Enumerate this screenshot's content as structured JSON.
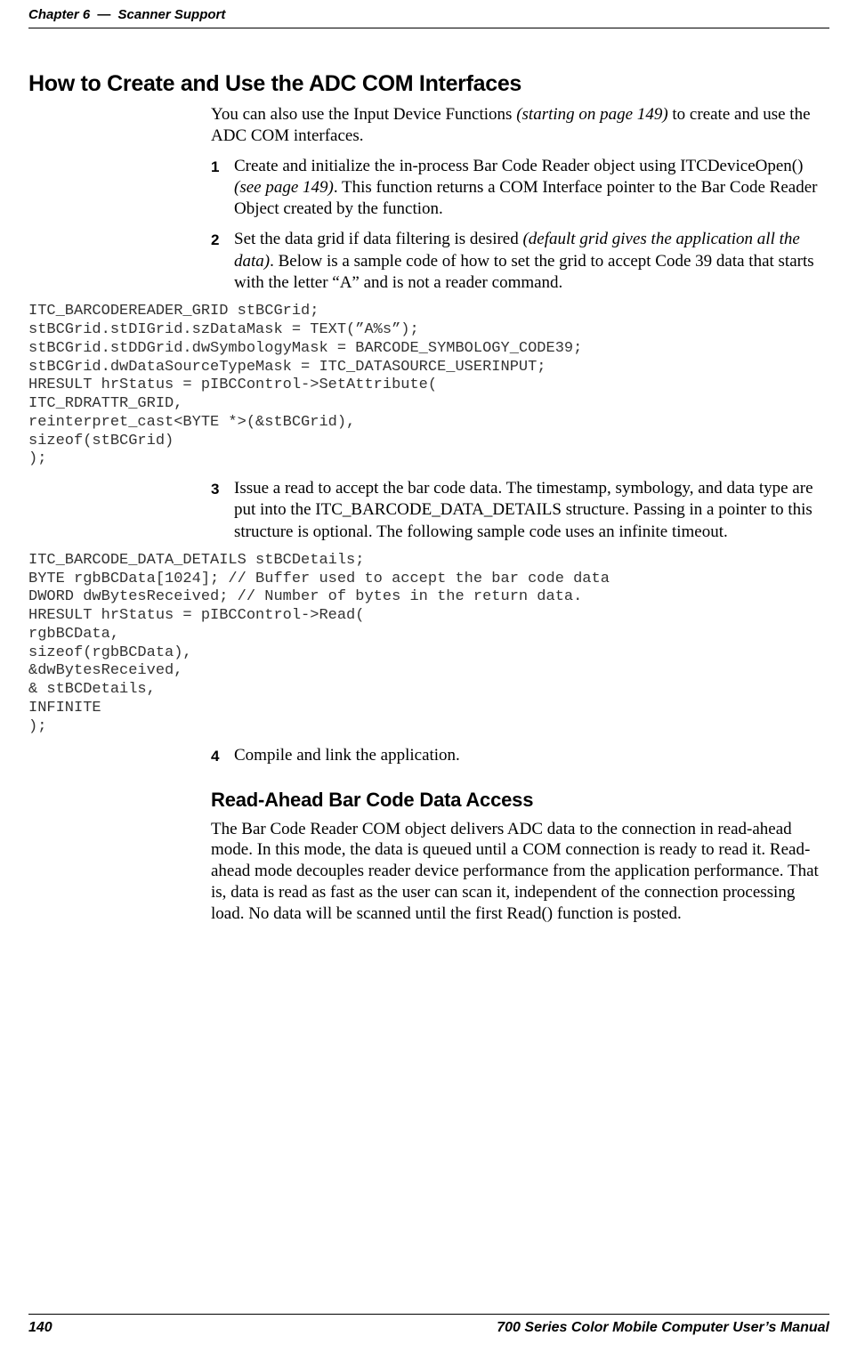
{
  "header": {
    "chapter_label": "Chapter 6",
    "separator": "—",
    "chapter_title": "Scanner Support"
  },
  "section_title": "How to Create and Use the ADC COM Interfaces",
  "intro": {
    "pre": "You can also use the Input Device Functions ",
    "italic": "(starting on page 149)",
    "post": " to create and use the ADC COM interfaces."
  },
  "steps12": {
    "s1": {
      "num": "1",
      "pre": "Create and initialize the in-process Bar Code Reader object using ITCDeviceOpen() ",
      "italic": "(see page 149)",
      "post": ". This function returns a COM Interface pointer to the Bar Code Reader Object created by the function."
    },
    "s2": {
      "num": "2",
      "pre": "Set the data grid if data filtering is desired ",
      "italic": "(default grid gives the application all the data)",
      "post": ". Below is a sample code of how to set the grid to accept Code 39 data that starts with the letter “A” and is not a reader command."
    }
  },
  "code1": "ITC_BARCODEREADER_GRID stBCGrid;\nstBCGrid.stDIGrid.szDataMask = TEXT(”A%s”);\nstBCGrid.stDDGrid.dwSymbologyMask = BARCODE_SYMBOLOGY_CODE39;\nstBCGrid.dwDataSourceTypeMask = ITC_DATASOURCE_USERINPUT;\nHRESULT hrStatus = pIBCControl->SetAttribute(\nITC_RDRATTR_GRID,\nreinterpret_cast<BYTE *>(&stBCGrid),\nsizeof(stBCGrid)\n);",
  "step3": {
    "num": "3",
    "text": "Issue a read to accept the bar code data. The timestamp, symbology, and data type are put into the ITC_BARCODE_DATA_DETAILS structure. Passing in a pointer to this structure is optional. The following sample code uses an infinite timeout."
  },
  "code2": "ITC_BARCODE_DATA_DETAILS stBCDetails;\nBYTE rgbBCData[1024]; // Buffer used to accept the bar code data\nDWORD dwBytesReceived; // Number of bytes in the return data.\nHRESULT hrStatus = pIBCControl->Read(\nrgbBCData,\nsizeof(rgbBCData),\n&dwBytesReceived,\n& stBCDetails,\nINFINITE\n);",
  "step4": {
    "num": "4",
    "text": "Compile and link the application."
  },
  "subsection_title": "Read-Ahead Bar Code Data Access",
  "subsection_body": "The Bar Code Reader COM object delivers ADC data to the connection in read-ahead mode. In this mode, the data is queued until a COM connection is ready to read it. Read-ahead mode decouples reader device performance from the application performance. That is, data is read as fast as the user can scan it, independent of the connection processing load. No data will be scanned until the first Read() function is posted.",
  "footer": {
    "page_num": "140",
    "manual_title": "700 Series Color Mobile Computer User’s Manual"
  }
}
